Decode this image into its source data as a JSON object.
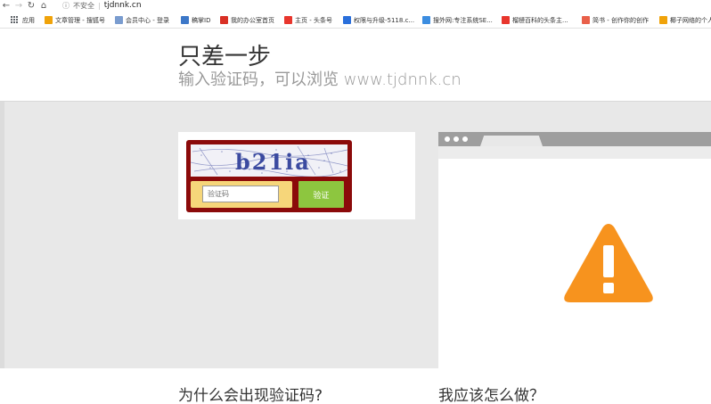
{
  "browser": {
    "nav": {
      "back_glyph": "←",
      "forward_glyph": "→",
      "reload_glyph": "↻",
      "home_glyph": "⌂",
      "info_glyph": "ⓘ"
    },
    "address": {
      "security_label": "不安全",
      "url": "tjdnnk.cn"
    },
    "bookmarks": [
      {
        "label": "应用",
        "icon": "apps-grid-icon",
        "color": "#5f6368"
      },
      {
        "label": "文章管理 - 搜狐号",
        "icon": "sohu-icon",
        "color": "#f0a30a"
      },
      {
        "label": "会员中心 - 登录",
        "icon": "page-icon",
        "color": "#7a9ccf"
      },
      {
        "label": "稿掌ID",
        "icon": "gear-icon",
        "color": "#3d78c8"
      },
      {
        "label": "我的办公室首页",
        "icon": "office-icon",
        "color": "#d93025"
      },
      {
        "label": "主页 - 头条号",
        "icon": "toutiao-icon",
        "color": "#e8362d"
      },
      {
        "label": "权限与升级-5118.c...",
        "icon": "globe-icon",
        "color": "#2a6fdb"
      },
      {
        "label": "搜外网:专注系统SE...",
        "icon": "s-icon",
        "color": "#3c8de0"
      },
      {
        "label": "榴槤百科的头条主...",
        "icon": "toutiao-icon",
        "color": "#e8362d"
      },
      {
        "label": "简书 - 创作你的创作",
        "icon": "jianshu-icon",
        "color": "#e9604a"
      },
      {
        "label": "椰子网络的个人...",
        "icon": "sohu-icon",
        "color": "#f0a30a"
      }
    ]
  },
  "page": {
    "title": "只差一步",
    "subtitle": "输入验证码，可以浏览 www.tjdnnk.cn",
    "captcha": {
      "image_text": "b21ia",
      "input_placeholder": "验证码",
      "submit_label": "验证"
    },
    "question_left": "为什么会出现验证码?",
    "question_right": "我应该怎么做？"
  },
  "colors": {
    "captcha_frame": "#8b0a0a",
    "captcha_form_bg": "#f6d67a",
    "submit_bg": "#8dc63f",
    "warning_orange": "#f7931e",
    "band_gray": "#e8e8e8"
  }
}
